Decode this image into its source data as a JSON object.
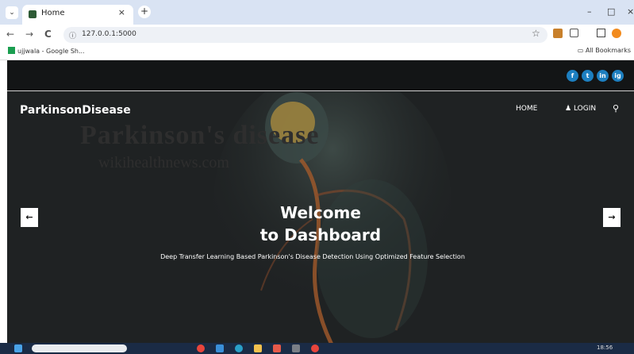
{
  "browser": {
    "tab_title": "Home",
    "tab_close": "×",
    "new_tab": "+",
    "tab_menu": "⌄",
    "window_controls": [
      "–",
      "□",
      "×"
    ],
    "nav": {
      "back": "←",
      "forward": "→",
      "reload": "C"
    },
    "url": "127.0.0.1:5000",
    "bookmark": "ujjwala - Google Sh...",
    "all_bookmarks": "All Bookmarks",
    "star": "☆"
  },
  "site": {
    "brand": "ParkinsonDisease",
    "nav": {
      "home": "HOME",
      "login": "LOGIN"
    },
    "social": [
      "f",
      "t",
      "in",
      "ig"
    ],
    "watermark": {
      "title": "Parkinson's disease",
      "site": "wikihealthnews.com"
    },
    "hero": {
      "line1": "Welcome",
      "line2": "to Dashboard",
      "subtitle": "Deep Transfer Learning Based Parkinson's Disease Detection Using Optimized Feature Selection"
    },
    "prev_arrow": "←",
    "next_arrow": "→"
  },
  "taskbar": {
    "time": "18:56"
  }
}
